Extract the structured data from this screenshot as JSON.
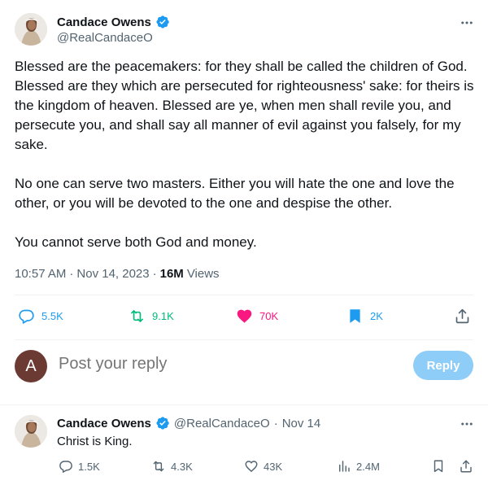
{
  "main_tweet": {
    "display_name": "Candace Owens",
    "handle": "@RealCandaceO",
    "paragraphs": [
      "Blessed are the peacemakers: for they shall be called the children of God. Blessed are they which are persecuted for righteousness' sake: for theirs is the kingdom of heaven. Blessed are ye, when men shall revile you, and persecute you, and shall say all manner of evil against you falsely, for my sake.",
      "No one can serve two masters. Either you will hate the one and love the other, or you will be devoted to the one and despise the other.",
      "You cannot serve both God and money."
    ],
    "time": "10:57 AM",
    "date": "Nov 14, 2023",
    "separator": "·",
    "views_count": "16M",
    "views_label": "Views",
    "replies": "5.5K",
    "reposts": "9.1K",
    "likes": "70K",
    "bookmarks": "2K"
  },
  "reply_box": {
    "avatar_letter": "A",
    "placeholder": "Post your reply",
    "button_label": "Reply"
  },
  "reply_tweet": {
    "display_name": "Candace Owens",
    "handle": "@RealCandaceO",
    "separator": "·",
    "date": "Nov 14",
    "text": "Christ is King.",
    "replies": "1.5K",
    "reposts": "4.3K",
    "likes": "43K",
    "views": "2.4M"
  },
  "colors": {
    "text": "#0f1419",
    "secondary": "#536471",
    "verified": "#1d9bf0",
    "reply_blue": "#1d9bf0",
    "repost_green": "#00ba7c",
    "like_pink": "#f91880",
    "bookmark_blue": "#1d9bf0",
    "reply_button_disabled": "#8ecdf8"
  },
  "icons": [
    "verified-badge-icon",
    "more-icon",
    "reply-icon",
    "repost-icon",
    "like-icon",
    "bookmark-icon",
    "share-icon",
    "views-icon"
  ]
}
